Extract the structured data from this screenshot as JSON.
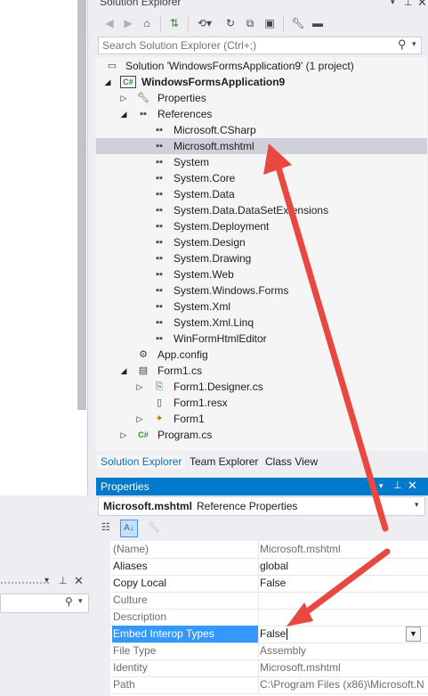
{
  "left_panel": {
    "pin_icon": "pin-icon",
    "close_icon": "close-icon",
    "search_icon": "search-icon"
  },
  "solution_explorer": {
    "title": "Solution Explorer",
    "search_placeholder": "Search Solution Explorer (Ctrl+;)",
    "tree": [
      {
        "label": "Solution 'WindowsFormsApplication9' (1 project)",
        "bold": false
      },
      {
        "label": "WindowsFormsApplication9",
        "bold": true
      },
      {
        "label": "Properties"
      },
      {
        "label": "References"
      },
      {
        "label": "Microsoft.CSharp"
      },
      {
        "label": "Microsoft.mshtml"
      },
      {
        "label": "System"
      },
      {
        "label": "System.Core"
      },
      {
        "label": "System.Data"
      },
      {
        "label": "System.Data.DataSetExtensions"
      },
      {
        "label": "System.Deployment"
      },
      {
        "label": "System.Design"
      },
      {
        "label": "System.Drawing"
      },
      {
        "label": "System.Web"
      },
      {
        "label": "System.Windows.Forms"
      },
      {
        "label": "System.Xml"
      },
      {
        "label": "System.Xml.Linq"
      },
      {
        "label": "WinFormHtmlEditor"
      },
      {
        "label": "App.config"
      },
      {
        "label": "Form1.cs"
      },
      {
        "label": "Form1.Designer.cs"
      },
      {
        "label": "Form1.resx"
      },
      {
        "label": "Form1"
      },
      {
        "label": "Program.cs"
      }
    ],
    "tabs": [
      "Solution Explorer",
      "Team Explorer",
      "Class View"
    ]
  },
  "properties": {
    "title": "Properties",
    "object_name": "Microsoft.mshtml",
    "object_type": "Reference Properties",
    "rows": [
      {
        "name": "(Name)",
        "value": "Microsoft.mshtml"
      },
      {
        "name": "Aliases",
        "value": "global"
      },
      {
        "name": "Copy Local",
        "value": "False"
      },
      {
        "name": "Culture",
        "value": ""
      },
      {
        "name": "Description",
        "value": ""
      },
      {
        "name": "Embed Interop Types",
        "value": "False"
      },
      {
        "name": "File Type",
        "value": "Assembly"
      },
      {
        "name": "Identity",
        "value": "Microsoft.mshtml"
      },
      {
        "name": "Path",
        "value": "C:\\Program Files (x86)\\Microsoft.N"
      }
    ]
  },
  "colors": {
    "accent": "#007acc",
    "selection": "#3399ff",
    "arrow": "#e8483f"
  }
}
